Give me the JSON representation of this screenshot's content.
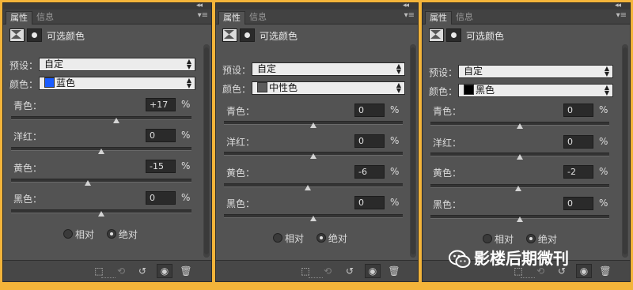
{
  "colors": {
    "blue_swatch": "#1a5cff",
    "gray_swatch": "#5c5c5c",
    "black_swatch": "#000000"
  },
  "panels": [
    {
      "tabs": [
        "属性",
        "信息"
      ],
      "title": "可选颜色",
      "preset_label": "预设：",
      "preset_value": "自定",
      "color_label": "颜色：",
      "color_value": "蓝色",
      "swatch_color": "#1a5cff",
      "params": [
        {
          "label": "青色：",
          "value": "+17",
          "pct": "%",
          "slider": 17
        },
        {
          "label": "洋红：",
          "value": "0",
          "pct": "%",
          "slider": 0
        },
        {
          "label": "黄色：",
          "value": "-15",
          "pct": "%",
          "slider": -15
        },
        {
          "label": "黑色：",
          "value": "0",
          "pct": "%",
          "slider": 0
        }
      ],
      "method": {
        "relative": "相对",
        "absolute": "绝对",
        "selected": "absolute"
      }
    },
    {
      "tabs": [
        "属性",
        "信息"
      ],
      "title": "可选颜色",
      "preset_label": "预设：",
      "preset_value": "自定",
      "color_label": "颜色：",
      "color_value": "中性色",
      "swatch_color": "#5c5c5c",
      "params": [
        {
          "label": "青色：",
          "value": "0",
          "pct": "%",
          "slider": 0
        },
        {
          "label": "洋红：",
          "value": "0",
          "pct": "%",
          "slider": 0
        },
        {
          "label": "黄色：",
          "value": "-6",
          "pct": "%",
          "slider": -6
        },
        {
          "label": "黑色：",
          "value": "0",
          "pct": "%",
          "slider": 0
        }
      ],
      "method": {
        "relative": "相对",
        "absolute": "绝对",
        "selected": "absolute"
      }
    },
    {
      "tabs": [
        "属性",
        "信息"
      ],
      "title": "可选颜色",
      "preset_label": "预设：",
      "preset_value": "自定",
      "color_label": "颜色：",
      "color_value": "黑色",
      "swatch_color": "#000000",
      "params": [
        {
          "label": "青色：",
          "value": "0",
          "pct": "%",
          "slider": 0
        },
        {
          "label": "洋红：",
          "value": "0",
          "pct": "%",
          "slider": 0
        },
        {
          "label": "黄色：",
          "value": "-2",
          "pct": "%",
          "slider": -2
        },
        {
          "label": "黑色：",
          "value": "0",
          "pct": "%",
          "slider": 0
        }
      ],
      "method": {
        "relative": "相对",
        "absolute": "绝对",
        "selected": "absolute"
      }
    }
  ],
  "footer_icons": [
    "clip-to-layer-icon",
    "view-previous-icon",
    "reset-icon",
    "visibility-eye-icon",
    "trash-icon"
  ],
  "watermark": "影楼后期微刊"
}
